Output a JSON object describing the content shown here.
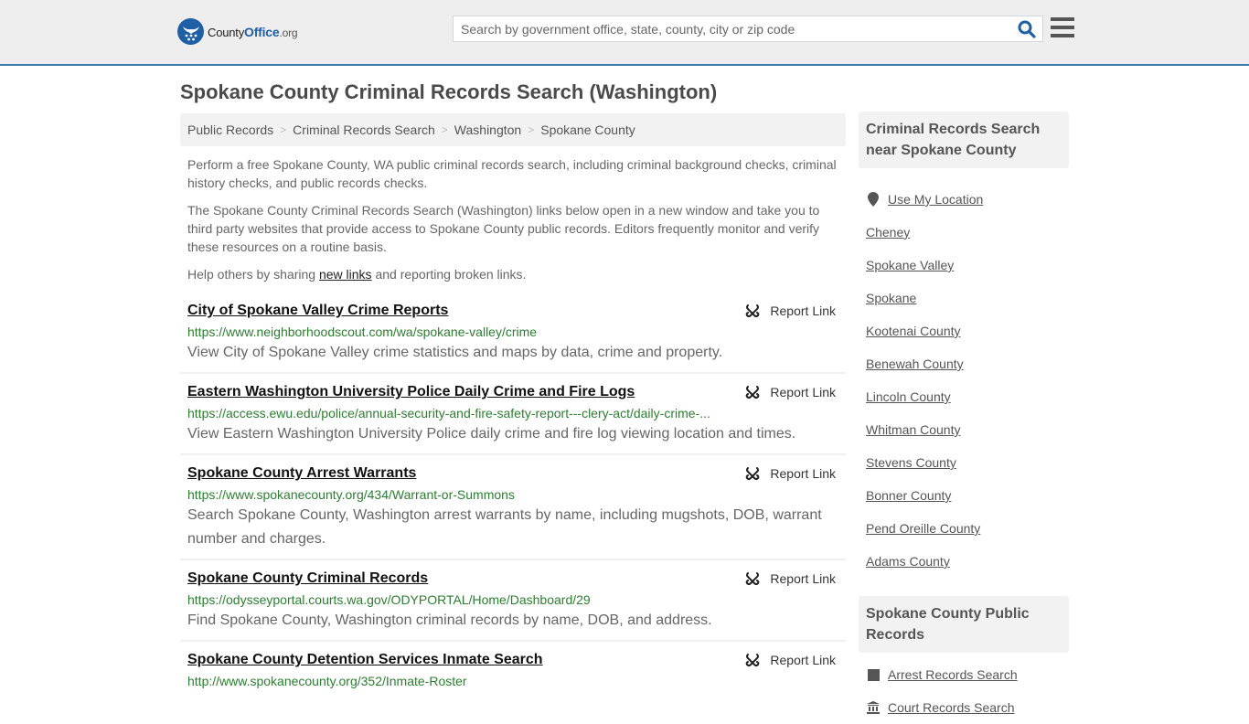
{
  "header": {
    "logo": {
      "name": "County",
      "name_accent": "Office",
      "tld": ".org"
    },
    "search": {
      "placeholder": "Search by government office, state, county, city or zip code",
      "value": ""
    },
    "icons": {
      "search": "search-icon",
      "menu": "hamburger-menu-icon"
    },
    "colors": {
      "brand": "#1f5fa6",
      "border_accent": "#3a7aa8"
    }
  },
  "page": {
    "title": "Spokane County Criminal Records Search (Washington)"
  },
  "breadcrumb": [
    {
      "label": "Public Records"
    },
    {
      "label": "Criminal Records Search"
    },
    {
      "label": "Washington"
    },
    {
      "label": "Spokane County"
    }
  ],
  "breadcrumb_separator": ">",
  "intro": {
    "p1": "Perform a free Spokane County, WA public criminal records search, including criminal background checks, criminal history checks, and public records checks.",
    "p2": "The Spokane County Criminal Records Search (Washington) links below open in a new window and take you to third party websites that provide access to Spokane County public records. Editors frequently monitor and verify these resources on a routine basis.",
    "p3_before": "Help others by sharing ",
    "p3_link": "new links",
    "p3_after": " and reporting broken links."
  },
  "results": [
    {
      "title": "City of Spokane Valley Crime Reports",
      "url": "https://www.neighborhoodscout.com/wa/spokane-valley/crime",
      "description": "View City of Spokane Valley crime statistics and maps by data, crime and property.",
      "report_label": "Report Link"
    },
    {
      "title": "Eastern Washington University Police Daily Crime and Fire Logs",
      "url": "https://access.ewu.edu/police/annual-security-and-fire-safety-report---clery-act/daily-crime-...",
      "description": "View Eastern Washington University Police daily crime and fire log viewing location and times.",
      "report_label": "Report Link"
    },
    {
      "title": "Spokane County Arrest Warrants",
      "url": "https://www.spokanecounty.org/434/Warrant-or-Summons",
      "description": "Search Spokane County, Washington arrest warrants by name, including mugshots, DOB, warrant number and charges.",
      "report_label": "Report Link"
    },
    {
      "title": "Spokane County Criminal Records",
      "url": "https://odysseyportal.courts.wa.gov/ODYPORTAL/Home/Dashboard/29",
      "description": "Find Spokane County, Washington criminal records by name, DOB, and address.",
      "report_label": "Report Link"
    },
    {
      "title": "Spokane County Detention Services Inmate Search",
      "url": "http://www.spokanecounty.org/352/Inmate-Roster",
      "description": "",
      "report_label": "Report Link"
    }
  ],
  "sidebar": {
    "nearby": {
      "heading": "Criminal Records Search near Spokane County",
      "use_location": "Use My Location",
      "items": [
        "Cheney",
        "Spokane Valley",
        "Spokane",
        "Kootenai County",
        "Benewah County",
        "Lincoln County",
        "Whitman County",
        "Stevens County",
        "Bonner County",
        "Pend Oreille County",
        "Adams County"
      ]
    },
    "public_records": {
      "heading": "Spokane County Public Records",
      "items": [
        {
          "label": "Arrest Records Search",
          "icon": "square-icon"
        },
        {
          "label": "Court Records Search",
          "icon": "courthouse-icon"
        }
      ]
    }
  }
}
